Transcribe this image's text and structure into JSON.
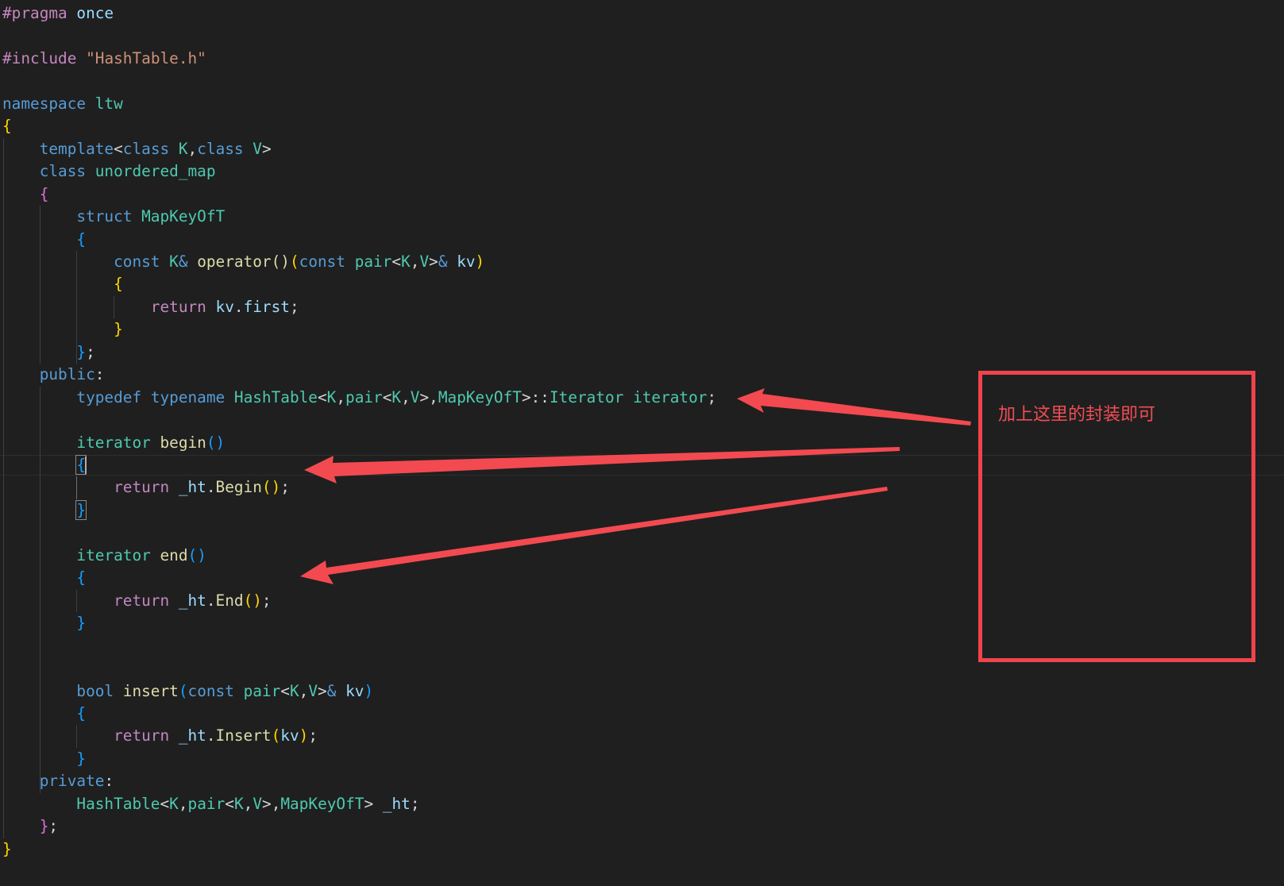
{
  "editor": {
    "theme_colors": {
      "background": "#1f1f1f",
      "keyword_blue": "#569cd6",
      "control_purple": "#c586c0",
      "type_teal": "#4ec9b0",
      "function_yellow": "#dcdcaa",
      "variable_lightblue": "#9cdcfe",
      "string_orange": "#ce9178",
      "bracket_gold": "#ffd700",
      "bracket_orchid": "#da70d6",
      "bracket_blue": "#179fff",
      "default_text": "#d4d4d4"
    },
    "lines": [
      [
        {
          "t": "#pragma",
          "c": "#c586c0"
        },
        {
          "t": " once",
          "c": "#9cdcfe"
        }
      ],
      [],
      [
        {
          "t": "#include",
          "c": "#c586c0"
        },
        {
          "t": " ",
          "c": "#d4d4d4"
        },
        {
          "t": "\"HashTable.h\"",
          "c": "#ce9178"
        }
      ],
      [],
      [
        {
          "t": "namespace",
          "c": "#569cd6"
        },
        {
          "t": " ltw",
          "c": "#4ec9b0"
        }
      ],
      [
        {
          "t": "{",
          "c": "#ffd700"
        }
      ],
      [
        {
          "t": "    ",
          "c": "#d4d4d4"
        },
        {
          "t": "template",
          "c": "#569cd6"
        },
        {
          "t": "<",
          "c": "#d4d4d4"
        },
        {
          "t": "class",
          "c": "#569cd6"
        },
        {
          "t": " K",
          "c": "#4ec9b0"
        },
        {
          "t": ",",
          "c": "#d4d4d4"
        },
        {
          "t": "class",
          "c": "#569cd6"
        },
        {
          "t": " V",
          "c": "#4ec9b0"
        },
        {
          "t": ">",
          "c": "#d4d4d4"
        }
      ],
      [
        {
          "t": "    ",
          "c": "#d4d4d4"
        },
        {
          "t": "class",
          "c": "#569cd6"
        },
        {
          "t": " unordered_map",
          "c": "#4ec9b0"
        }
      ],
      [
        {
          "t": "    ",
          "c": "#d4d4d4"
        },
        {
          "t": "{",
          "c": "#da70d6"
        }
      ],
      [
        {
          "t": "        ",
          "c": "#d4d4d4"
        },
        {
          "t": "struct",
          "c": "#569cd6"
        },
        {
          "t": " MapKeyOfT",
          "c": "#4ec9b0"
        }
      ],
      [
        {
          "t": "        ",
          "c": "#d4d4d4"
        },
        {
          "t": "{",
          "c": "#179fff"
        }
      ],
      [
        {
          "t": "            ",
          "c": "#d4d4d4"
        },
        {
          "t": "const",
          "c": "#569cd6"
        },
        {
          "t": " K",
          "c": "#4ec9b0"
        },
        {
          "t": "&",
          "c": "#569cd6"
        },
        {
          "t": " operator",
          "c": "#dcdcaa"
        },
        {
          "t": "()",
          "c": "#dcdcaa"
        },
        {
          "t": "(",
          "c": "#ffd700"
        },
        {
          "t": "const",
          "c": "#569cd6"
        },
        {
          "t": " pair",
          "c": "#4ec9b0"
        },
        {
          "t": "<",
          "c": "#d4d4d4"
        },
        {
          "t": "K",
          "c": "#4ec9b0"
        },
        {
          "t": ",",
          "c": "#d4d4d4"
        },
        {
          "t": "V",
          "c": "#4ec9b0"
        },
        {
          "t": ">",
          "c": "#d4d4d4"
        },
        {
          "t": "&",
          "c": "#569cd6"
        },
        {
          "t": " kv",
          "c": "#9cdcfe"
        },
        {
          "t": ")",
          "c": "#ffd700"
        }
      ],
      [
        {
          "t": "            ",
          "c": "#d4d4d4"
        },
        {
          "t": "{",
          "c": "#ffd700"
        }
      ],
      [
        {
          "t": "                ",
          "c": "#d4d4d4"
        },
        {
          "t": "return",
          "c": "#c586c0"
        },
        {
          "t": " kv",
          "c": "#9cdcfe"
        },
        {
          "t": ".",
          "c": "#d4d4d4"
        },
        {
          "t": "first",
          "c": "#9cdcfe"
        },
        {
          "t": ";",
          "c": "#d4d4d4"
        }
      ],
      [
        {
          "t": "            ",
          "c": "#d4d4d4"
        },
        {
          "t": "}",
          "c": "#ffd700"
        }
      ],
      [
        {
          "t": "        ",
          "c": "#d4d4d4"
        },
        {
          "t": "}",
          "c": "#179fff"
        },
        {
          "t": ";",
          "c": "#d4d4d4"
        }
      ],
      [
        {
          "t": "    ",
          "c": "#d4d4d4"
        },
        {
          "t": "public",
          "c": "#569cd6"
        },
        {
          "t": ":",
          "c": "#d4d4d4"
        }
      ],
      [
        {
          "t": "        ",
          "c": "#d4d4d4"
        },
        {
          "t": "typedef",
          "c": "#569cd6"
        },
        {
          "t": " typename",
          "c": "#569cd6"
        },
        {
          "t": " HashTable",
          "c": "#4ec9b0"
        },
        {
          "t": "<",
          "c": "#d4d4d4"
        },
        {
          "t": "K",
          "c": "#4ec9b0"
        },
        {
          "t": ",",
          "c": "#d4d4d4"
        },
        {
          "t": "pair",
          "c": "#4ec9b0"
        },
        {
          "t": "<",
          "c": "#d4d4d4"
        },
        {
          "t": "K",
          "c": "#4ec9b0"
        },
        {
          "t": ",",
          "c": "#d4d4d4"
        },
        {
          "t": "V",
          "c": "#4ec9b0"
        },
        {
          "t": ">",
          "c": "#d4d4d4"
        },
        {
          "t": ",",
          "c": "#d4d4d4"
        },
        {
          "t": "MapKeyOfT",
          "c": "#4ec9b0"
        },
        {
          "t": ">",
          "c": "#d4d4d4"
        },
        {
          "t": "::",
          "c": "#d4d4d4"
        },
        {
          "t": "Iterator",
          "c": "#4ec9b0"
        },
        {
          "t": " iterator",
          "c": "#4ec9b0"
        },
        {
          "t": ";",
          "c": "#d4d4d4"
        }
      ],
      [],
      [
        {
          "t": "        ",
          "c": "#d4d4d4"
        },
        {
          "t": "iterator",
          "c": "#4ec9b0"
        },
        {
          "t": " begin",
          "c": "#dcdcaa"
        },
        {
          "t": "()",
          "c": "#179fff"
        }
      ],
      [
        {
          "t": "        ",
          "c": "#d4d4d4"
        },
        {
          "t": "{",
          "c": "#179fff"
        }
      ],
      [
        {
          "t": "            ",
          "c": "#d4d4d4"
        },
        {
          "t": "return",
          "c": "#c586c0"
        },
        {
          "t": " _ht",
          "c": "#9cdcfe"
        },
        {
          "t": ".",
          "c": "#d4d4d4"
        },
        {
          "t": "Begin",
          "c": "#dcdcaa"
        },
        {
          "t": "()",
          "c": "#ffd700"
        },
        {
          "t": ";",
          "c": "#d4d4d4"
        }
      ],
      [
        {
          "t": "        ",
          "c": "#d4d4d4"
        },
        {
          "t": "}",
          "c": "#179fff"
        }
      ],
      [],
      [
        {
          "t": "        ",
          "c": "#d4d4d4"
        },
        {
          "t": "iterator",
          "c": "#4ec9b0"
        },
        {
          "t": " end",
          "c": "#dcdcaa"
        },
        {
          "t": "()",
          "c": "#179fff"
        }
      ],
      [
        {
          "t": "        ",
          "c": "#d4d4d4"
        },
        {
          "t": "{",
          "c": "#179fff"
        }
      ],
      [
        {
          "t": "            ",
          "c": "#d4d4d4"
        },
        {
          "t": "return",
          "c": "#c586c0"
        },
        {
          "t": " _ht",
          "c": "#9cdcfe"
        },
        {
          "t": ".",
          "c": "#d4d4d4"
        },
        {
          "t": "End",
          "c": "#dcdcaa"
        },
        {
          "t": "()",
          "c": "#ffd700"
        },
        {
          "t": ";",
          "c": "#d4d4d4"
        }
      ],
      [
        {
          "t": "        ",
          "c": "#d4d4d4"
        },
        {
          "t": "}",
          "c": "#179fff"
        }
      ],
      [],
      [],
      [
        {
          "t": "        ",
          "c": "#d4d4d4"
        },
        {
          "t": "bool",
          "c": "#569cd6"
        },
        {
          "t": " insert",
          "c": "#dcdcaa"
        },
        {
          "t": "(",
          "c": "#179fff"
        },
        {
          "t": "const",
          "c": "#569cd6"
        },
        {
          "t": " pair",
          "c": "#4ec9b0"
        },
        {
          "t": "<",
          "c": "#d4d4d4"
        },
        {
          "t": "K",
          "c": "#4ec9b0"
        },
        {
          "t": ",",
          "c": "#d4d4d4"
        },
        {
          "t": "V",
          "c": "#4ec9b0"
        },
        {
          "t": ">",
          "c": "#d4d4d4"
        },
        {
          "t": "&",
          "c": "#569cd6"
        },
        {
          "t": " kv",
          "c": "#9cdcfe"
        },
        {
          "t": ")",
          "c": "#179fff"
        }
      ],
      [
        {
          "t": "        ",
          "c": "#d4d4d4"
        },
        {
          "t": "{",
          "c": "#179fff"
        }
      ],
      [
        {
          "t": "            ",
          "c": "#d4d4d4"
        },
        {
          "t": "return",
          "c": "#c586c0"
        },
        {
          "t": " _ht",
          "c": "#9cdcfe"
        },
        {
          "t": ".",
          "c": "#d4d4d4"
        },
        {
          "t": "Insert",
          "c": "#dcdcaa"
        },
        {
          "t": "(",
          "c": "#ffd700"
        },
        {
          "t": "kv",
          "c": "#9cdcfe"
        },
        {
          "t": ")",
          "c": "#ffd700"
        },
        {
          "t": ";",
          "c": "#d4d4d4"
        }
      ],
      [
        {
          "t": "        ",
          "c": "#d4d4d4"
        },
        {
          "t": "}",
          "c": "#179fff"
        }
      ],
      [
        {
          "t": "    ",
          "c": "#d4d4d4"
        },
        {
          "t": "private",
          "c": "#569cd6"
        },
        {
          "t": ":",
          "c": "#d4d4d4"
        }
      ],
      [
        {
          "t": "        ",
          "c": "#d4d4d4"
        },
        {
          "t": "HashTable",
          "c": "#4ec9b0"
        },
        {
          "t": "<",
          "c": "#d4d4d4"
        },
        {
          "t": "K",
          "c": "#4ec9b0"
        },
        {
          "t": ",",
          "c": "#d4d4d4"
        },
        {
          "t": "pair",
          "c": "#4ec9b0"
        },
        {
          "t": "<",
          "c": "#d4d4d4"
        },
        {
          "t": "K",
          "c": "#4ec9b0"
        },
        {
          "t": ",",
          "c": "#d4d4d4"
        },
        {
          "t": "V",
          "c": "#4ec9b0"
        },
        {
          "t": ">",
          "c": "#d4d4d4"
        },
        {
          "t": ",",
          "c": "#d4d4d4"
        },
        {
          "t": "MapKeyOfT",
          "c": "#4ec9b0"
        },
        {
          "t": ">",
          "c": "#d4d4d4"
        },
        {
          "t": " _ht",
          "c": "#9cdcfe"
        },
        {
          "t": ";",
          "c": "#d4d4d4"
        }
      ],
      [
        {
          "t": "    ",
          "c": "#d4d4d4"
        },
        {
          "t": "}",
          "c": "#da70d6"
        },
        {
          "t": ";",
          "c": "#d4d4d4"
        }
      ],
      [
        {
          "t": "}",
          "c": "#ffd700"
        }
      ]
    ]
  },
  "annotation": {
    "text": "加上这里的封装即可",
    "color": "#f0434b"
  }
}
